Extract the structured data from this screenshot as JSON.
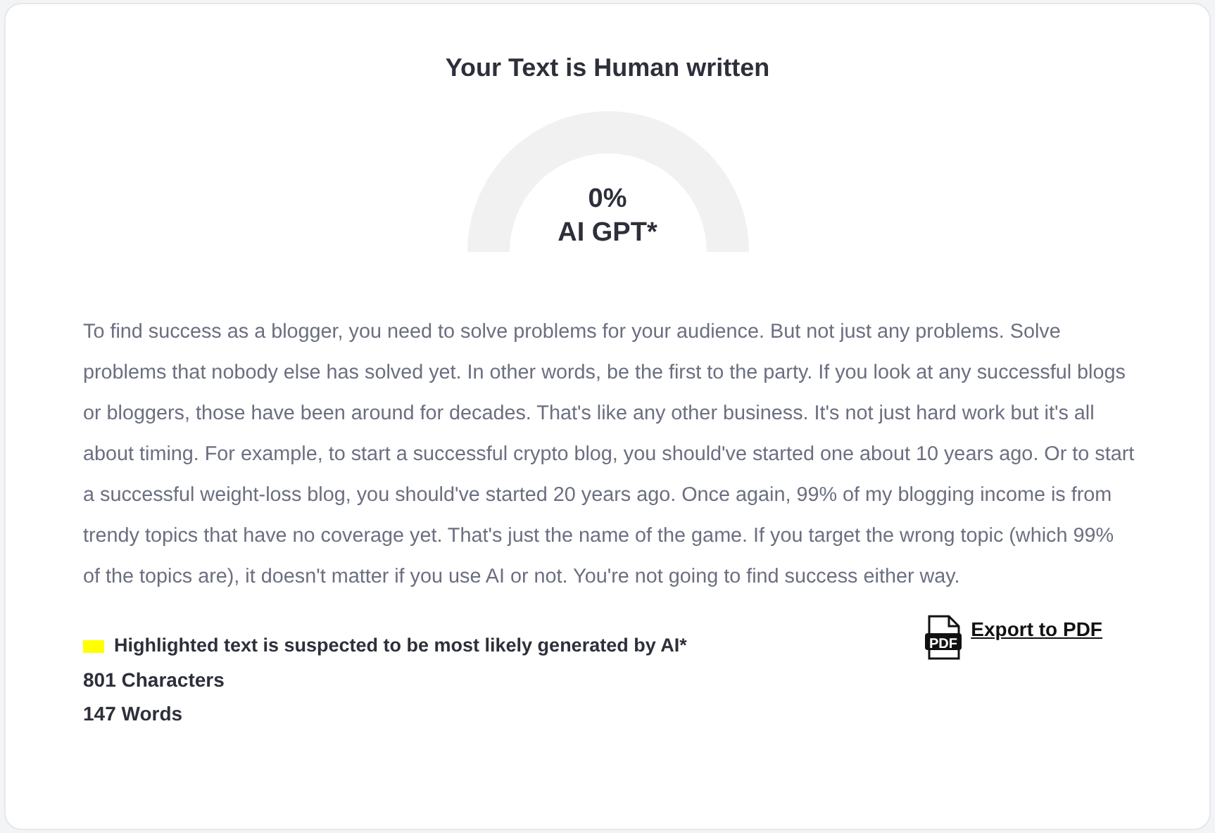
{
  "result": {
    "title": "Your Text is Human written",
    "gauge": {
      "value": "0%",
      "label": "AI GPT*"
    },
    "text": "To find success as a blogger, you need to solve problems for your audience. But not just any problems. Solve problems that nobody else has solved yet. In other words, be the first to the party. If you look at any successful blogs or bloggers, those have been around for decades. That's like any other business. It's not just hard work but it's all about timing. For example, to start a successful crypto blog, you should've started one about 10 years ago. Or to start a successful weight-loss blog, you should've started 20 years ago. Once again, 99% of my blogging income is from trendy topics that have no coverage yet. That's just the name of the game. If you target the wrong topic (which 99% of the topics are), it doesn't matter if you use AI or not. You're not going to find success either way.",
    "legend": {
      "color": "#ffff00",
      "label": "Highlighted text is suspected to be most likely generated by AI*"
    },
    "stats": [
      "801 Characters",
      "147 Words"
    ],
    "export": {
      "icon_text": "PDF",
      "label": "Export to PDF"
    }
  }
}
